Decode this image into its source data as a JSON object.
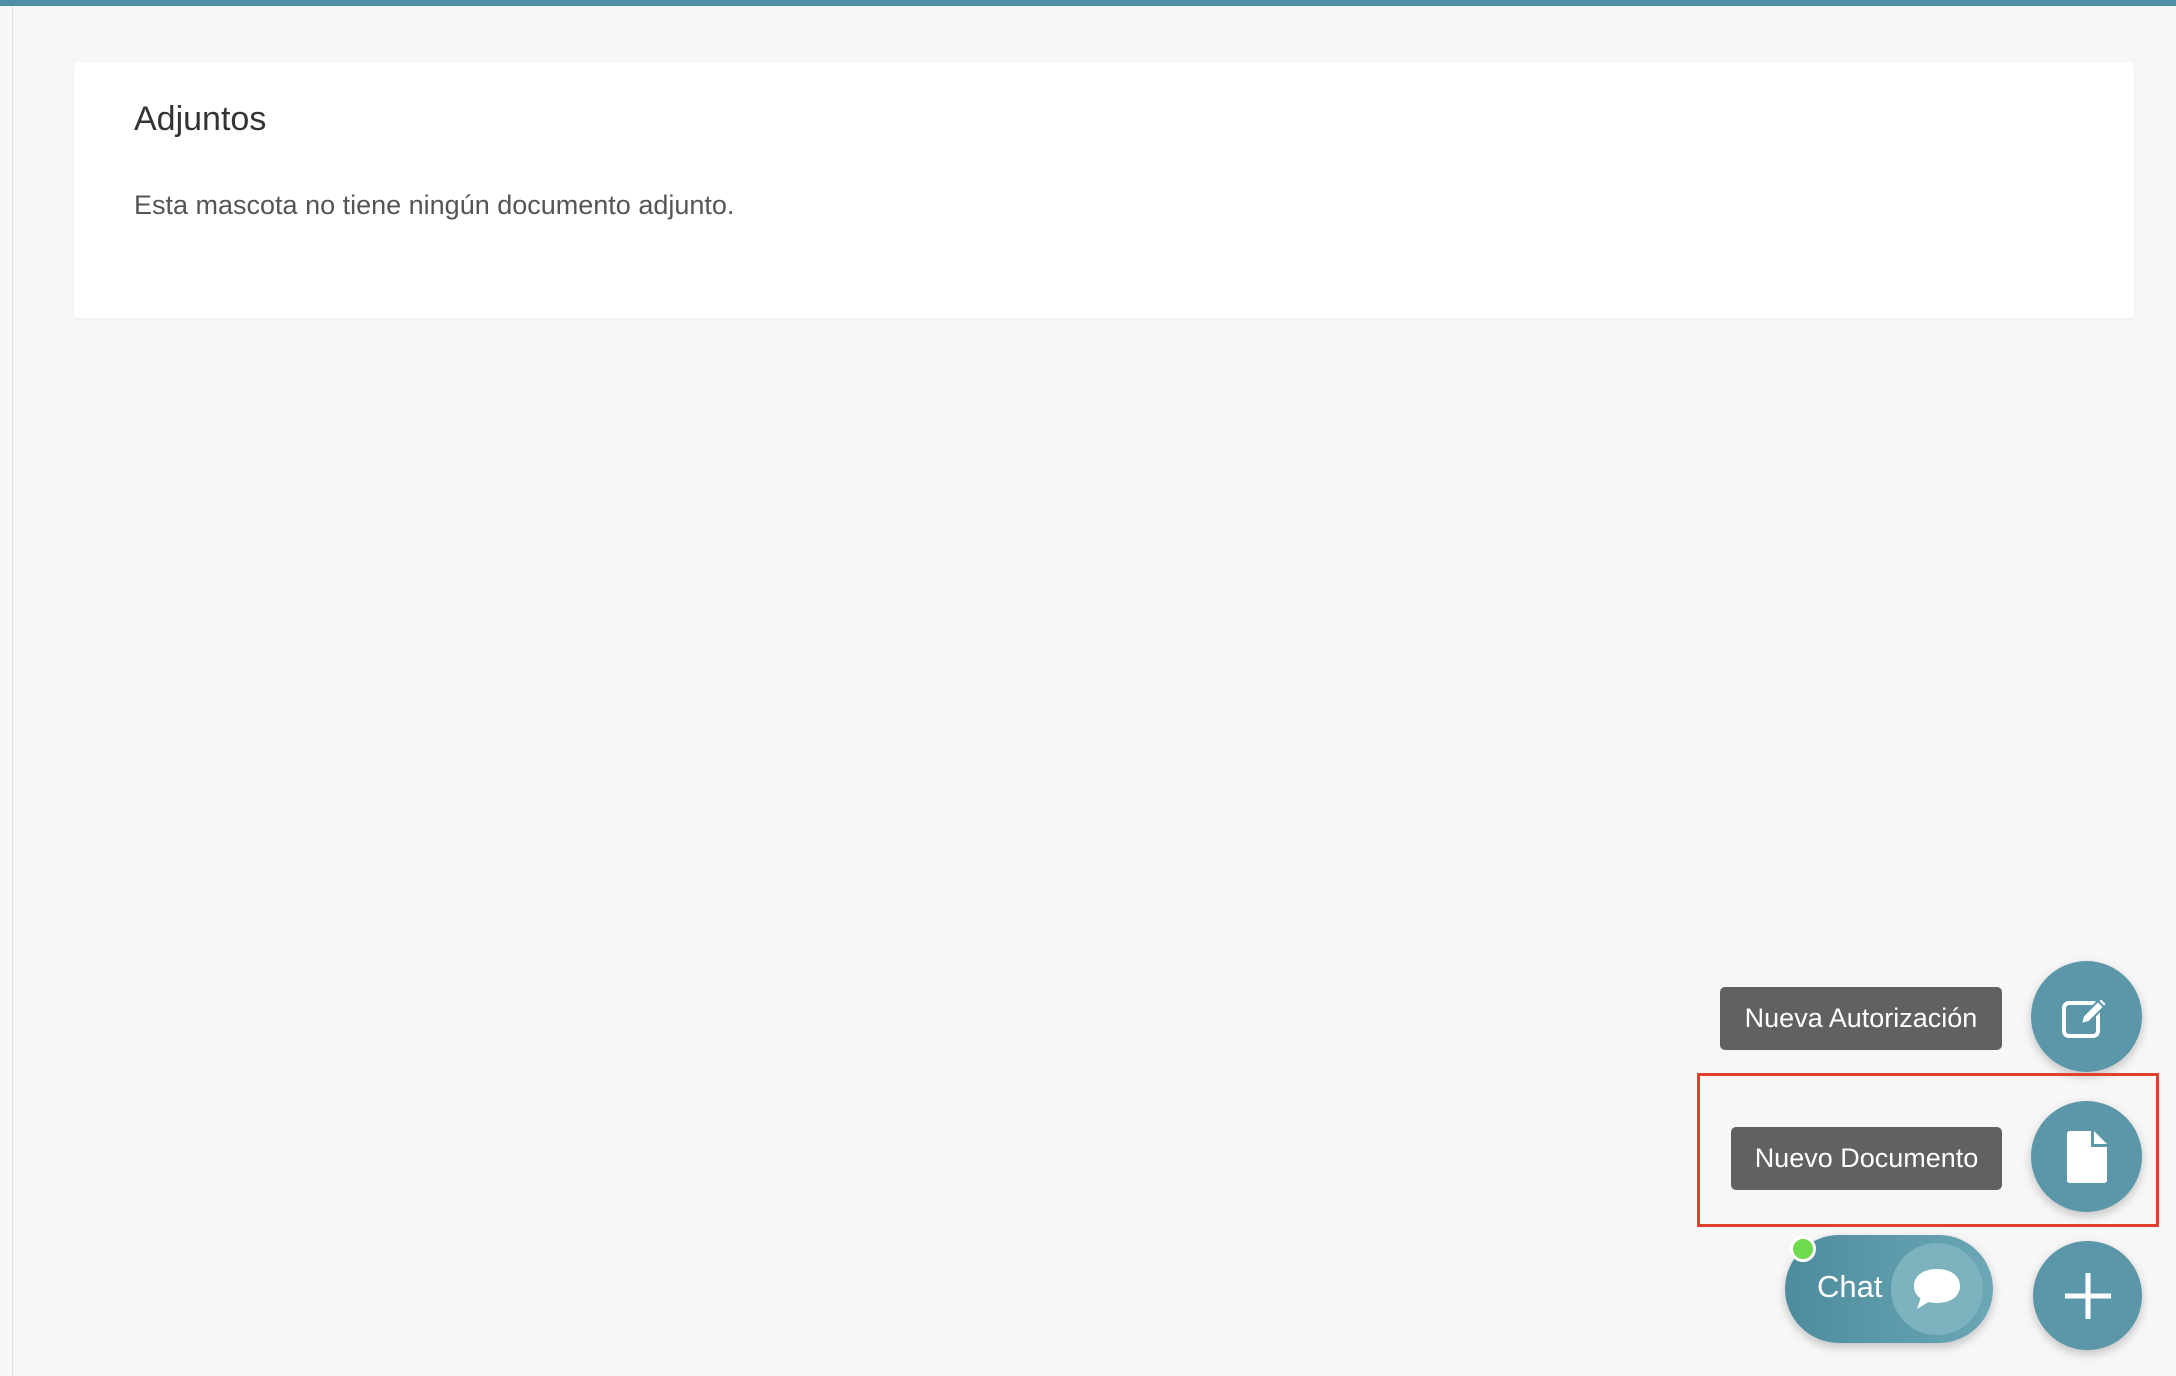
{
  "colors": {
    "accent": "#5b97a9",
    "topbar": "#4f8fa3",
    "tooltip_bg": "#616161",
    "highlight": "#e0402e",
    "online": "#6edb4e"
  },
  "attachments": {
    "title": "Adjuntos",
    "empty_message": "Esta mascota no tiene ningún documento adjunto."
  },
  "fab_menu": {
    "authorization": {
      "label": "Nueva Autorización",
      "icon": "edit-icon"
    },
    "document": {
      "label": "Nuevo Documento",
      "icon": "file-icon"
    },
    "main": {
      "icon": "plus-icon"
    }
  },
  "chat": {
    "label": "Chat",
    "icon": "chat-bubble-icon",
    "status": "online"
  }
}
